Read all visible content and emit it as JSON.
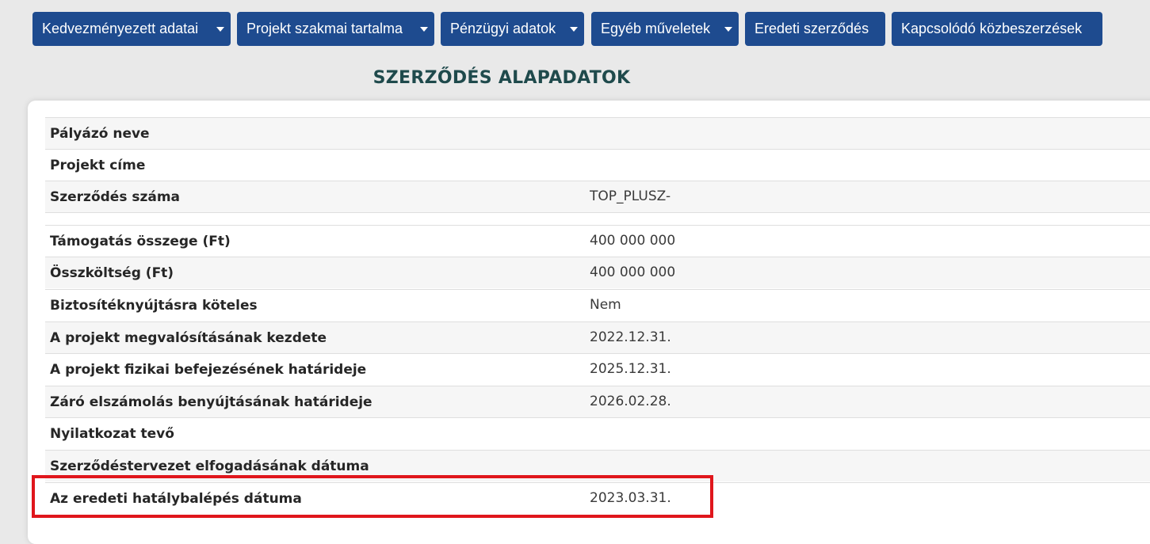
{
  "nav": {
    "buttons": [
      {
        "label": "Kedvezményezett adatai",
        "has_dropdown": true
      },
      {
        "label": "Projekt szakmai tartalma",
        "has_dropdown": true
      },
      {
        "label": "Pénzügyi adatok",
        "has_dropdown": true
      },
      {
        "label": "Egyéb műveletek",
        "has_dropdown": true
      },
      {
        "label": "Eredeti szerződés",
        "has_dropdown": false
      },
      {
        "label": "Kapcsolódó közbeszerzések",
        "has_dropdown": false
      }
    ]
  },
  "page_title": "SZERZŐDÉS ALAPADATOK",
  "rows": [
    {
      "label": "Pályázó neve",
      "value": ""
    },
    {
      "label": "Projekt címe",
      "value": ""
    },
    {
      "label": "Szerződés száma",
      "value": "TOP_PLUSZ-"
    },
    {
      "label": "",
      "value": ""
    },
    {
      "label": "Támogatás összege (Ft)",
      "value": "400 000 000"
    },
    {
      "label": "Összköltség (Ft)",
      "value": "400 000 000"
    },
    {
      "label": "Biztosítéknyújtásra köteles",
      "value": "Nem"
    },
    {
      "label": "A projekt megvalósításának kezdete",
      "value": "2022.12.31."
    },
    {
      "label": "A projekt fizikai befejezésének határideje",
      "value": "2025.12.31."
    },
    {
      "label": "Záró elszámolás benyújtásának határideje",
      "value": "2026.02.28."
    },
    {
      "label": "Nyilatkozat tevő",
      "value": ""
    },
    {
      "label": "Szerződéstervezet elfogadásának dátuma",
      "value": ""
    },
    {
      "label": "Az eredeti hatálybalépés dátuma",
      "value": "2023.03.31."
    }
  ],
  "colors": {
    "nav_button_bg": "#1e4b8f",
    "title_color": "#1f4a4c",
    "highlight_border": "#e0161c",
    "page_bg": "#e9e9e9"
  }
}
